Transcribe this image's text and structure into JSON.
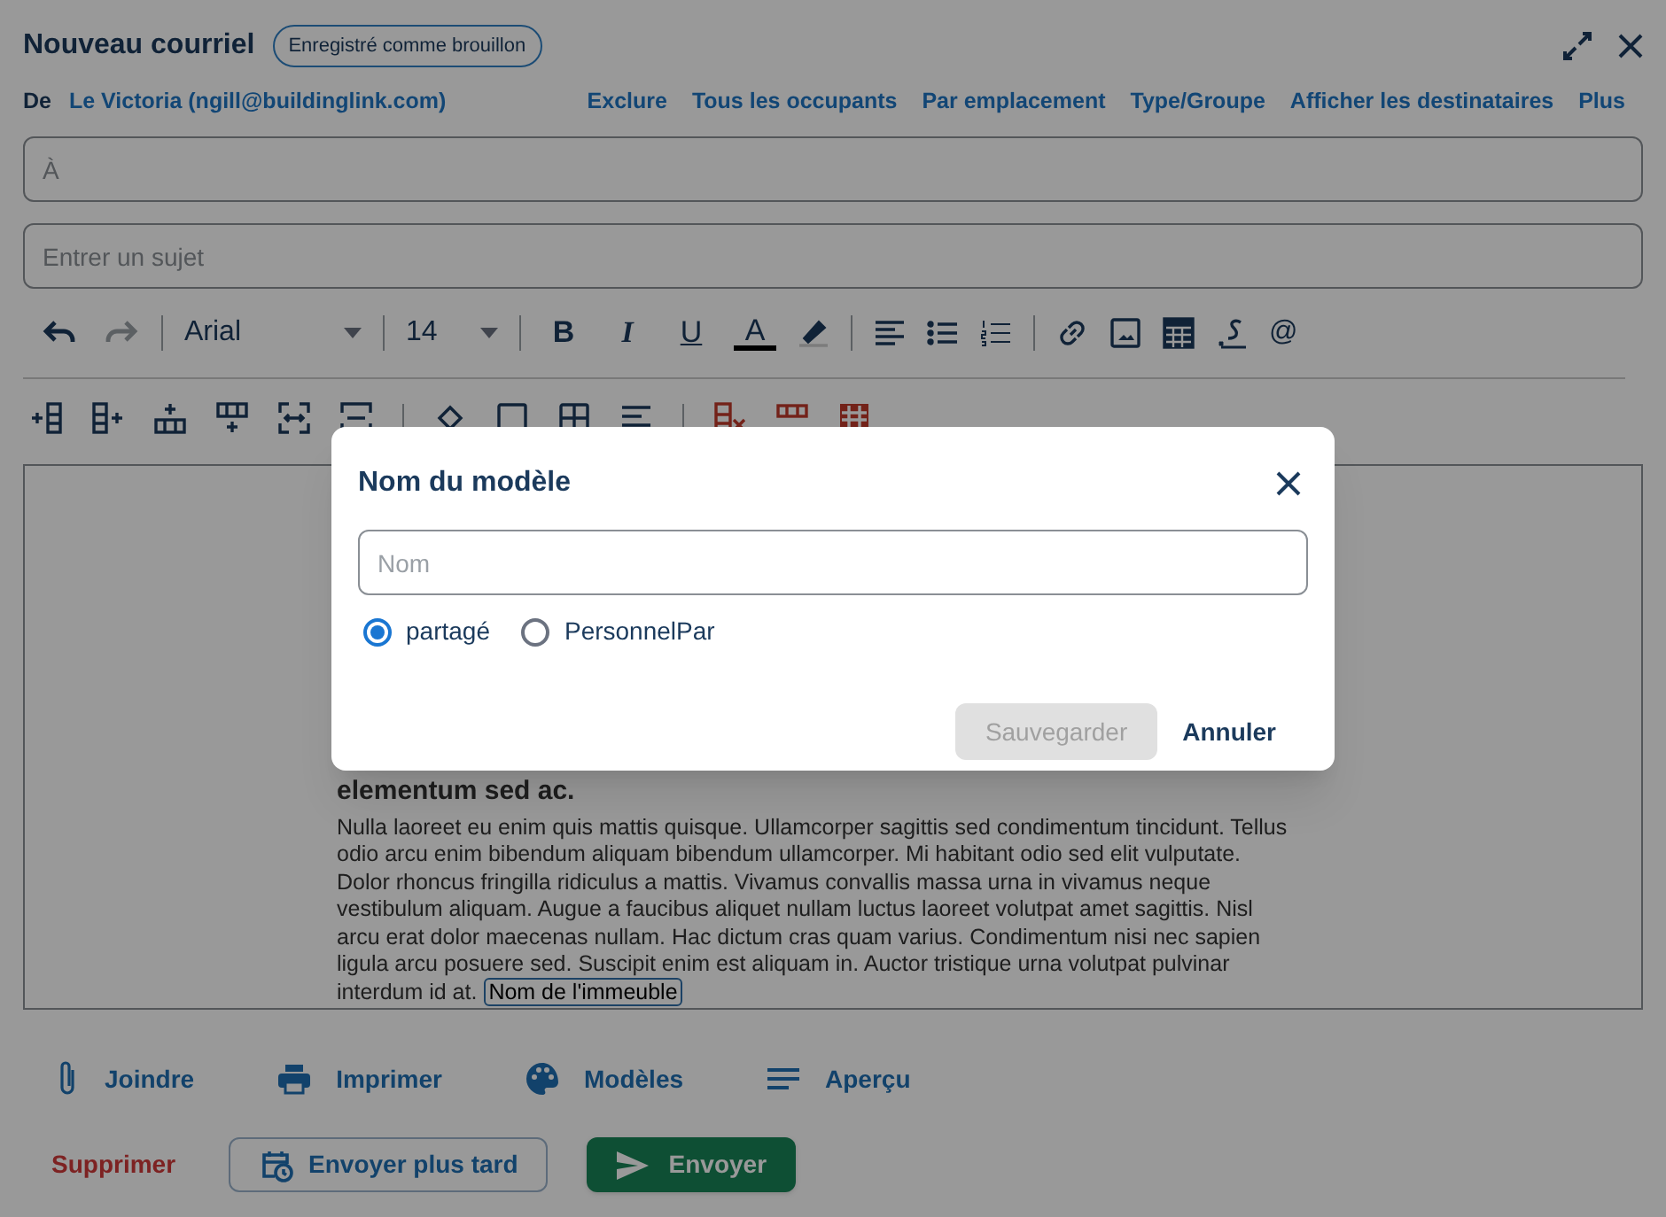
{
  "window": {
    "title": "Nouveau courriel",
    "badge": "Enregistré comme brouillon"
  },
  "sender": {
    "label": "De",
    "value": "Le Victoria (ngill@buildinglink.com)"
  },
  "recipient_links": [
    "Exclure",
    "Tous les occupants",
    "Par emplacement",
    "Type/Groupe",
    "Afficher les destinataires",
    "Plus"
  ],
  "to_field": {
    "placeholder": "À"
  },
  "subject_field": {
    "placeholder": "Entrer un sujet"
  },
  "toolbar": {
    "history": [
      {
        "kind": "undo",
        "disabled": false
      },
      {
        "kind": "redo",
        "disabled": true
      }
    ],
    "font": "Arial",
    "size": "14",
    "format_buttons": [
      {
        "kind": "bold",
        "label": "B"
      },
      {
        "kind": "italic",
        "label": "I"
      },
      {
        "kind": "underline",
        "label": "U"
      },
      {
        "kind": "color",
        "label": "A"
      }
    ],
    "mention": "@"
  },
  "editor": {
    "heading": "elementum sed ac.",
    "body": "Nulla laoreet eu enim quis mattis quisque. Ullamcorper sagittis sed condimentum tincidunt. Tellus odio arcu enim bibendum aliquam bibendum ullamcorper. Mi habitant odio sed elit vulputate. Dolor rhoncus fringilla ridiculus a mattis. Vivamus convallis massa urna in vivamus neque vestibulum aliquam. Augue a faucibus aliquet nullam luctus laoreet volutpat amet sagittis. Nisl arcu erat dolor maecenas nullam. Hac dictum cras quam varius. Condimentum nisi nec sapien ligula arcu posuere sed. Suscipit enim est aliquam in. Auctor tristique urna volutpat pulvinar interdum id at.",
    "merge_field": "Nom de l'immeuble"
  },
  "actions": [
    {
      "kind": "attach",
      "label": "Joindre"
    },
    {
      "kind": "print",
      "label": "Imprimer"
    },
    {
      "kind": "templates",
      "label": "Modèles"
    },
    {
      "kind": "preview",
      "label": "Aperçu"
    }
  ],
  "footer": {
    "delete": "Supprimer",
    "schedule": "Envoyer plus tard",
    "send": "Envoyer"
  },
  "dialog": {
    "title": "Nom du modèle",
    "name_field": {
      "placeholder": "Nom"
    },
    "options": [
      {
        "label": "partagé",
        "selected": true
      },
      {
        "label": "PersonnelPar",
        "selected": false
      }
    ],
    "save": {
      "label": "Sauvegarder",
      "disabled": true
    },
    "cancel": "Annuler"
  }
}
